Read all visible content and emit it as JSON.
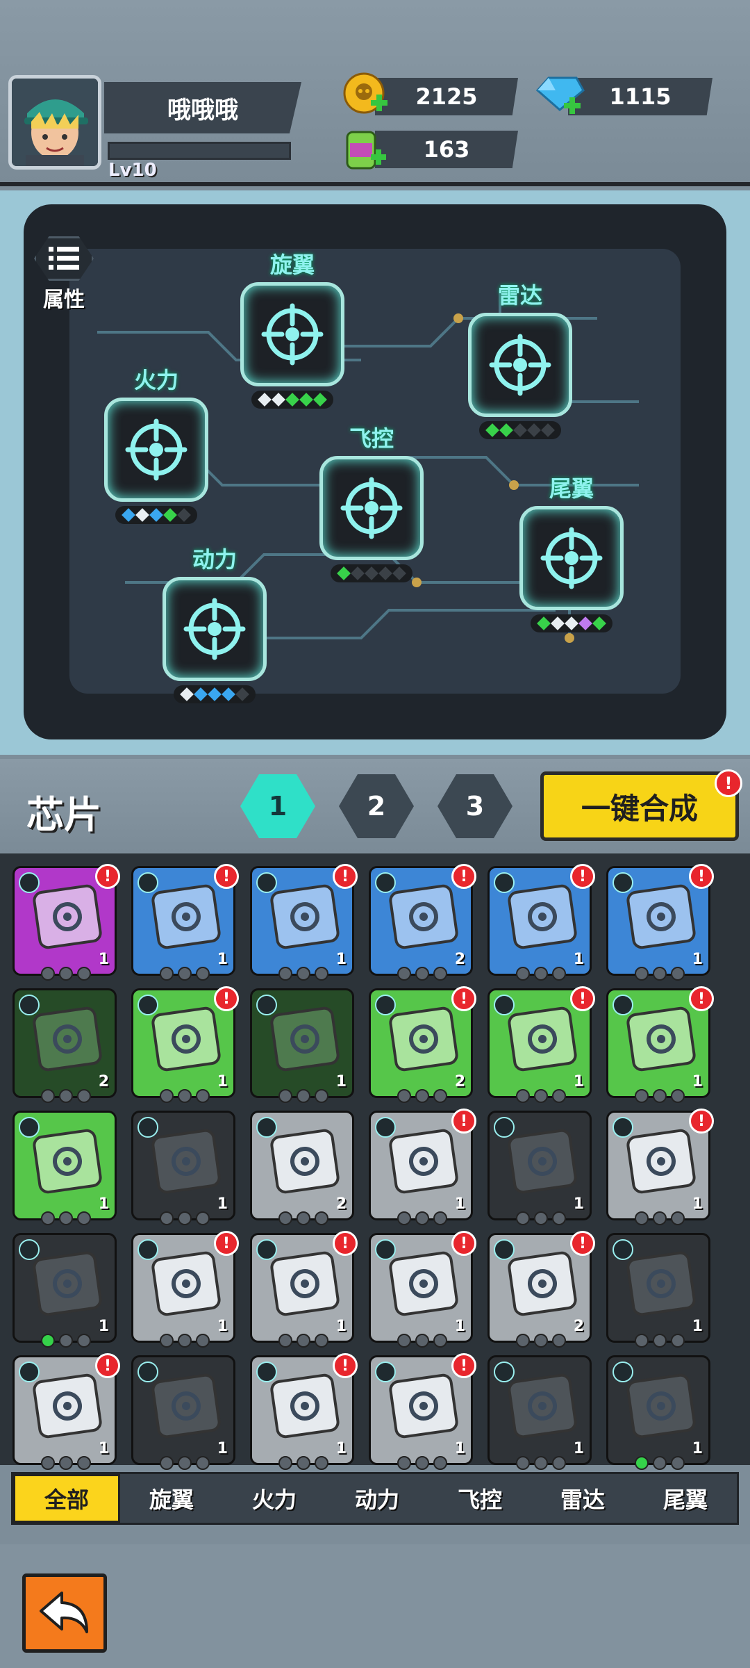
{
  "player": {
    "name": "哦哦哦",
    "level": "Lv10",
    "xp_fraction": 0.0
  },
  "resources": {
    "gold": "2125",
    "gems": "1115",
    "fuel": "163",
    "gold_color": "#f3b91d",
    "gem_color": "#40b8f0",
    "fuel_color": "#7dd04a"
  },
  "board": {
    "attr_label": "属性",
    "nodes": [
      {
        "id": "xuanyi",
        "title": "旋翼",
        "gems": [
          "white",
          "white",
          "green",
          "green",
          "green"
        ]
      },
      {
        "id": "leida",
        "title": "雷达",
        "gems": [
          "green",
          "green",
          "empty",
          "empty",
          "empty"
        ]
      },
      {
        "id": "huoli",
        "title": "火力",
        "gems": [
          "blue",
          "white",
          "blue",
          "green",
          "empty"
        ]
      },
      {
        "id": "feikong",
        "title": "飞控",
        "gems": [
          "green",
          "empty",
          "empty",
          "empty",
          "empty"
        ]
      },
      {
        "id": "weiyi",
        "title": "尾翼",
        "gems": [
          "green",
          "white",
          "white",
          "purple",
          "green"
        ]
      },
      {
        "id": "dongli",
        "title": "动力",
        "gems": [
          "white",
          "blue",
          "blue",
          "blue",
          "empty"
        ]
      }
    ]
  },
  "chips": {
    "title": "芯片",
    "pages": [
      "1",
      "2",
      "3"
    ],
    "active_page": 0,
    "merge_label": "一键合成",
    "alert_mark": "!",
    "grid": [
      {
        "tier": "purple",
        "count": "1",
        "alert": true,
        "lit": 0
      },
      {
        "tier": "blue",
        "count": "1",
        "alert": true,
        "lit": 0
      },
      {
        "tier": "blue",
        "count": "1",
        "alert": true,
        "lit": 0
      },
      {
        "tier": "blue",
        "count": "2",
        "alert": true,
        "lit": 0
      },
      {
        "tier": "blue",
        "count": "1",
        "alert": true,
        "lit": 0
      },
      {
        "tier": "blue",
        "count": "1",
        "alert": true,
        "lit": 0
      },
      {
        "tier": "darkgreen",
        "count": "2",
        "alert": false,
        "lit": 0
      },
      {
        "tier": "green",
        "count": "1",
        "alert": true,
        "lit": 0
      },
      {
        "tier": "darkgreen",
        "count": "1",
        "alert": false,
        "lit": 0
      },
      {
        "tier": "green",
        "count": "2",
        "alert": true,
        "lit": 0
      },
      {
        "tier": "green",
        "count": "1",
        "alert": true,
        "lit": 0
      },
      {
        "tier": "green",
        "count": "1",
        "alert": true,
        "lit": 0
      },
      {
        "tier": "green",
        "count": "1",
        "alert": false,
        "lit": 0
      },
      {
        "tier": "dark",
        "count": "1",
        "alert": false,
        "lit": 0
      },
      {
        "tier": "gray",
        "count": "2",
        "alert": false,
        "lit": 0
      },
      {
        "tier": "gray",
        "count": "1",
        "alert": true,
        "lit": 0
      },
      {
        "tier": "dark",
        "count": "1",
        "alert": false,
        "lit": 0
      },
      {
        "tier": "gray",
        "count": "1",
        "alert": true,
        "lit": 0
      },
      {
        "tier": "dark",
        "count": "1",
        "alert": false,
        "lit": 1
      },
      {
        "tier": "gray",
        "count": "1",
        "alert": true,
        "lit": 0
      },
      {
        "tier": "gray",
        "count": "1",
        "alert": true,
        "lit": 0
      },
      {
        "tier": "gray",
        "count": "1",
        "alert": true,
        "lit": 0
      },
      {
        "tier": "gray",
        "count": "2",
        "alert": true,
        "lit": 0
      },
      {
        "tier": "dark",
        "count": "1",
        "alert": false,
        "lit": 0
      },
      {
        "tier": "gray",
        "count": "1",
        "alert": true,
        "lit": 0
      },
      {
        "tier": "dark",
        "count": "1",
        "alert": false,
        "lit": 0
      },
      {
        "tier": "gray",
        "count": "1",
        "alert": true,
        "lit": 0
      },
      {
        "tier": "gray",
        "count": "1",
        "alert": true,
        "lit": 0
      },
      {
        "tier": "dark",
        "count": "1",
        "alert": false,
        "lit": 0
      },
      {
        "tier": "dark",
        "count": "1",
        "alert": false,
        "lit": 1
      }
    ]
  },
  "categories": [
    "全部",
    "旋翼",
    "火力",
    "动力",
    "飞控",
    "雷达",
    "尾翼"
  ],
  "active_category": 0,
  "icons": {
    "back": "back-arrow-icon",
    "attr": "list-icon",
    "gold": "skull-coin-icon",
    "gem": "diamond-icon",
    "fuel": "fuel-can-icon",
    "plus": "plus-icon"
  },
  "colors": {
    "accent_teal": "#2fe0c8",
    "merge_yellow": "#f7d417",
    "alert_red": "#e8262d",
    "back_orange": "#f47a1c"
  }
}
